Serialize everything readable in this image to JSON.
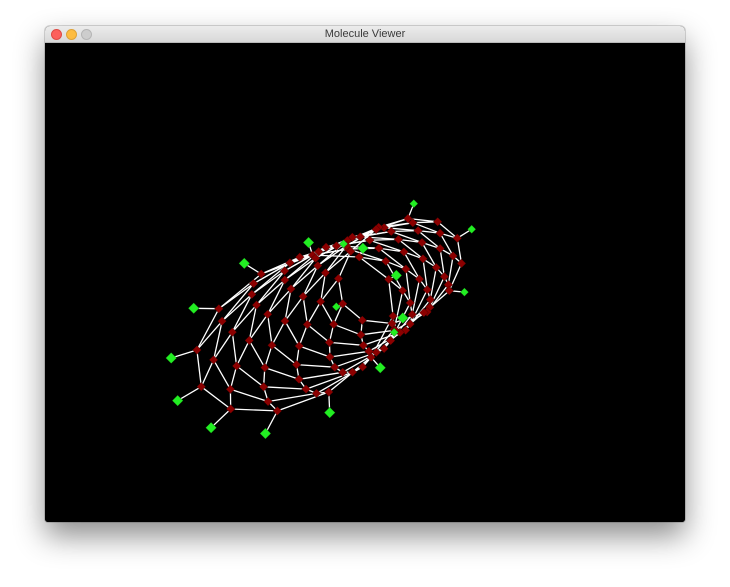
{
  "window": {
    "title": "Molecule Viewer"
  },
  "viewport": {
    "background": "#000000"
  },
  "molecule": {
    "structure": "nanotube",
    "atom_colors": {
      "carbon": "#8b0000",
      "hydrogen": "#22ee22"
    },
    "bond_color": "#ffffff"
  },
  "colors": {
    "close": "#fc605c",
    "minimize": "#fdbc40",
    "zoom": "#cdcdcd"
  }
}
